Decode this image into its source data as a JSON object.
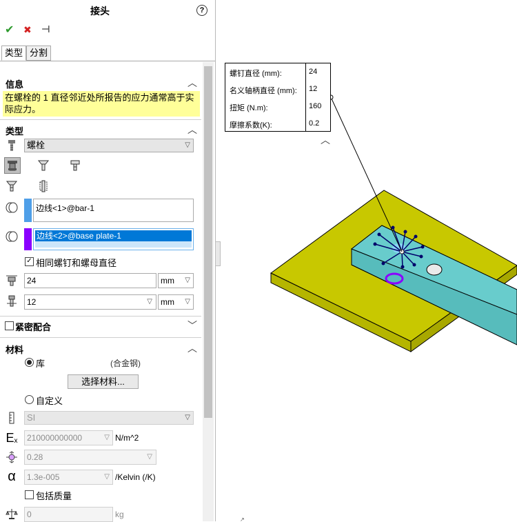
{
  "panel": {
    "title": "接头",
    "help": "?",
    "toolbar": {
      "ok": "✔",
      "cancel": "✖",
      "pin": "⊣"
    },
    "tabs": [
      "类型",
      "分割"
    ],
    "info": {
      "header": "信息",
      "message": "在螺栓的 1 直径邻近处所报告的应力通常高于实际应力。"
    },
    "type": {
      "header": "类型",
      "connector_type": "螺栓",
      "edges": [
        "边线<1>@bar-1",
        "边线<2>@base plate-1"
      ],
      "same_diameter_label": "相同螺钉和螺母直径",
      "head_diameter": "24",
      "head_unit": "mm",
      "shank_diameter": "12",
      "shank_unit": "mm"
    },
    "tight_fit": {
      "header": "紧密配合"
    },
    "material": {
      "header": "材料",
      "library_label": "库",
      "library_value": "(合金钢)",
      "select_button": "选择材料...",
      "custom_label": "自定义",
      "units": "SI",
      "ex_value": "210000000000",
      "ex_unit": "N/m^2",
      "poisson_value": "0.28",
      "alpha_value": "1.3e-005",
      "alpha_unit": "/Kelvin (/K)",
      "include_mass_label": "包括质量",
      "mass_value": "0",
      "mass_unit": "kg"
    }
  },
  "callout": {
    "rows": [
      {
        "label": "螺钉直径 (mm):",
        "value": "24"
      },
      {
        "label": "名义轴柄直径 (mm):",
        "value": "12"
      },
      {
        "label": "扭矩 (N.m):",
        "value": "160"
      },
      {
        "label": "摩擦系数(K):",
        "value": "0.2"
      }
    ]
  },
  "colors": {
    "base_plate": "#c8c800",
    "bar": "#5fc4c4",
    "highlight_stripe_1": "#4f9fe8",
    "highlight_stripe_2": "#8a00ff",
    "selection": "#0078d7",
    "info_bg": "#ffff99"
  }
}
